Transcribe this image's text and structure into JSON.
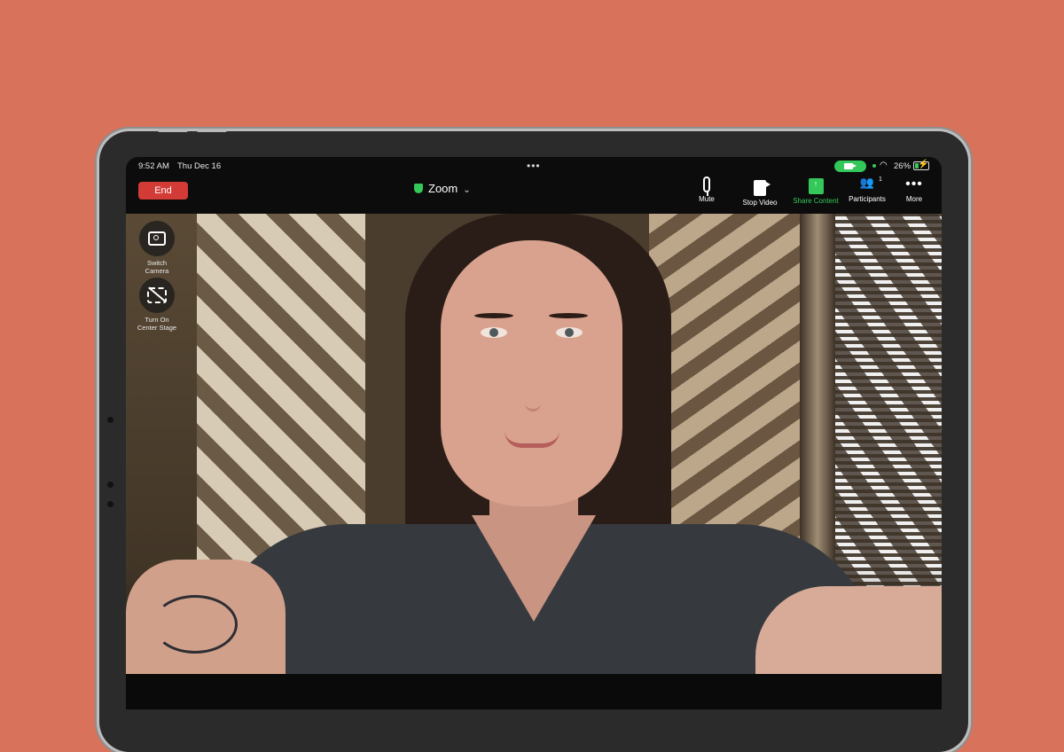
{
  "status_bar": {
    "time": "9:52 AM",
    "date": "Thu Dec 16",
    "battery": "26%"
  },
  "toolbar": {
    "end_label": "End",
    "meeting_title": "Zoom",
    "tools": [
      {
        "label": "Mute",
        "icon": "microphone-icon"
      },
      {
        "label": "Stop Video",
        "icon": "video-camera-icon"
      },
      {
        "label": "Share Content",
        "icon": "share-screen-icon"
      },
      {
        "label": "Participants",
        "icon": "participants-icon",
        "count": "1"
      },
      {
        "label": "More",
        "icon": "more-dots-icon"
      }
    ]
  },
  "video": {
    "side_controls": [
      {
        "label_line1": "Switch Camera",
        "label_line2": "",
        "icon": "switch-camera-icon"
      },
      {
        "label_line1": "Turn On",
        "label_line2": "Center Stage",
        "icon": "center-stage-icon"
      }
    ]
  },
  "colors": {
    "background": "#d9725a",
    "end_button": "#d23b36",
    "accent_green": "#34c759"
  }
}
